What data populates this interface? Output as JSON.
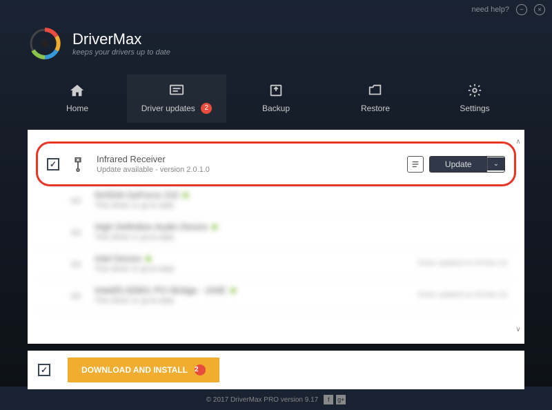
{
  "titlebar": {
    "help": "need help?"
  },
  "header": {
    "title": "DriverMax",
    "tagline": "keeps your drivers up to date"
  },
  "nav": {
    "home": "Home",
    "updates": "Driver updates",
    "updates_badge": "2",
    "backup": "Backup",
    "restore": "Restore",
    "settings": "Settings"
  },
  "drivers": {
    "row0": {
      "name": "Infrared Receiver",
      "status": "Update available - version 2.0.1.0",
      "update_label": "Update"
    },
    "row1": {
      "name": "NVIDIA GeForce 210",
      "status": "This driver is up-to-date"
    },
    "row2": {
      "name": "High Definition Audio Device",
      "status": "This driver is up-to-date"
    },
    "row3": {
      "name": "Intel Device",
      "status": "This driver is up-to-date",
      "date": "Driver updated on 03-Nov-16"
    },
    "row4": {
      "name": "Intel(R) 82801 PCI Bridge - 244E",
      "status": "This driver is up-to-date",
      "date": "Driver updated on 03-Nov-16"
    }
  },
  "actions": {
    "install": "DOWNLOAD AND INSTALL",
    "install_badge": "2"
  },
  "footer": {
    "copyright": "© 2017 DriverMax PRO version 9.17"
  }
}
